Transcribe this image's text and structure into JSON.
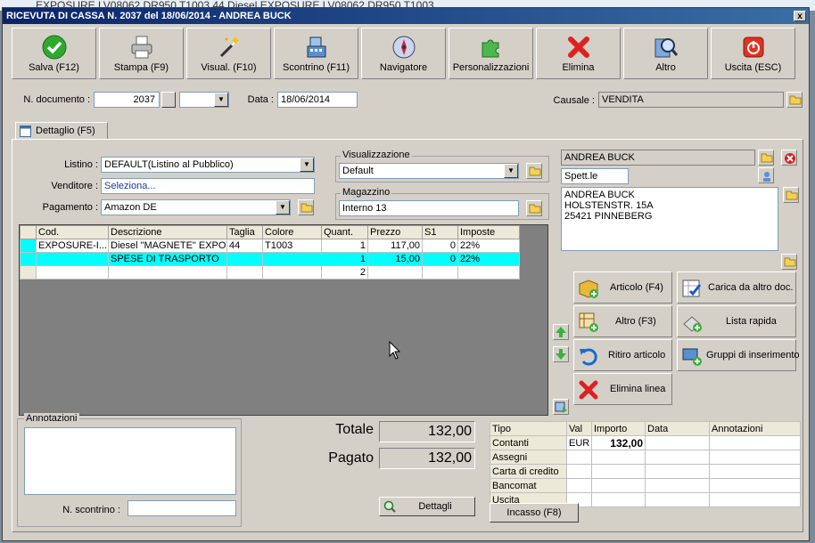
{
  "background_title": "EXPOSURE LV08062 DR950 T1003  44   Diesel EXPOSURE LV08062 DR950 T1003",
  "window": {
    "title": "RICEVUTA DI CASSA N. 2037 del 18/06/2014 - ANDREA BUCK",
    "close": "x"
  },
  "toolbar": [
    {
      "label": "Salva (F12)",
      "icon": "check-icon"
    },
    {
      "label": "Stampa (F9)",
      "icon": "printer-icon"
    },
    {
      "label": "Visual. (F10)",
      "icon": "magic-wand-icon"
    },
    {
      "label": "Scontrino (F11)",
      "icon": "cash-register-icon"
    },
    {
      "label": "Navigatore",
      "icon": "compass-icon"
    },
    {
      "label": "Personalizzazioni",
      "icon": "puzzle-icon"
    },
    {
      "label": "Elimina",
      "icon": "delete-x-icon"
    },
    {
      "label": "Altro",
      "icon": "magnifier-icon"
    },
    {
      "label": "Uscita (ESC)",
      "icon": "power-icon"
    }
  ],
  "header": {
    "doc_label": "N. documento :",
    "doc_value": "2037",
    "data_label": "Data :",
    "data_value": "18/06/2014",
    "causale_label": "Causale :",
    "causale_value": "VENDITA"
  },
  "tab": {
    "label": "Dettaglio (F5)"
  },
  "form": {
    "listino_label": "Listino :",
    "listino_value": "DEFAULT(Listino al Pubblico)",
    "venditore_label": "Venditore :",
    "venditore_value": "Seleziona...",
    "pagamento_label": "Pagamento :",
    "pagamento_value": "Amazon DE",
    "visualizzazione_label": "Visualizzazione",
    "visualizzazione_value": "Default",
    "magazzino_label": "Magazzino",
    "magazzino_value": "Interno 13"
  },
  "customer": {
    "name": "ANDREA BUCK",
    "salutation": "Spett.le",
    "address": [
      "ANDREA BUCK",
      "HOLSTENSTR. 15A",
      "25421 PINNEBERG"
    ]
  },
  "grid": {
    "columns": [
      "Cod.",
      "Descrizione",
      "Taglia",
      "Colore",
      "Quant.",
      "Prezzo",
      "S1",
      "Imposte"
    ],
    "rows": [
      [
        "EXPOSURE-I...",
        "Diesel \"MAGNETE\" EXPO...",
        "44",
        "T1003",
        "1",
        "117,00",
        "0",
        "22%"
      ],
      [
        "",
        "SPESE DI TRASPORTO",
        "",
        "",
        "1",
        "15,00",
        "0",
        "22%"
      ],
      [
        "",
        "",
        "",
        "",
        "2",
        "",
        "",
        ""
      ]
    ]
  },
  "actions": {
    "articolo": "Articolo (F4)",
    "carica": "Carica da altro doc.",
    "altro": "Altro (F3)",
    "lista": "Lista rapida",
    "ritiro": "Ritiro articolo",
    "gruppi": "Gruppi di inserimento",
    "elimina_linea": "Elimina linea"
  },
  "notes": {
    "label": "Annotazioni",
    "scontrino_label": "N. scontrino :"
  },
  "totals": {
    "totale_label": "Totale",
    "totale_value": "132,00",
    "pagato_label": "Pagato",
    "pagato_value": "132,00",
    "dettagli": "Dettagli"
  },
  "payments": {
    "columns": [
      "Tipo",
      "Val",
      "Importo",
      "Data",
      "Annotazioni"
    ],
    "rows": [
      [
        "Contanti",
        "EUR",
        "132,00",
        "",
        ""
      ],
      [
        "Assegni",
        "",
        "",
        "",
        ""
      ],
      [
        "Carta di credito",
        "",
        "",
        "",
        ""
      ],
      [
        "Bancomat",
        "",
        "",
        "",
        ""
      ],
      [
        "Uscita",
        "",
        "",
        "",
        ""
      ]
    ],
    "incasso": "Incasso (F8)"
  }
}
